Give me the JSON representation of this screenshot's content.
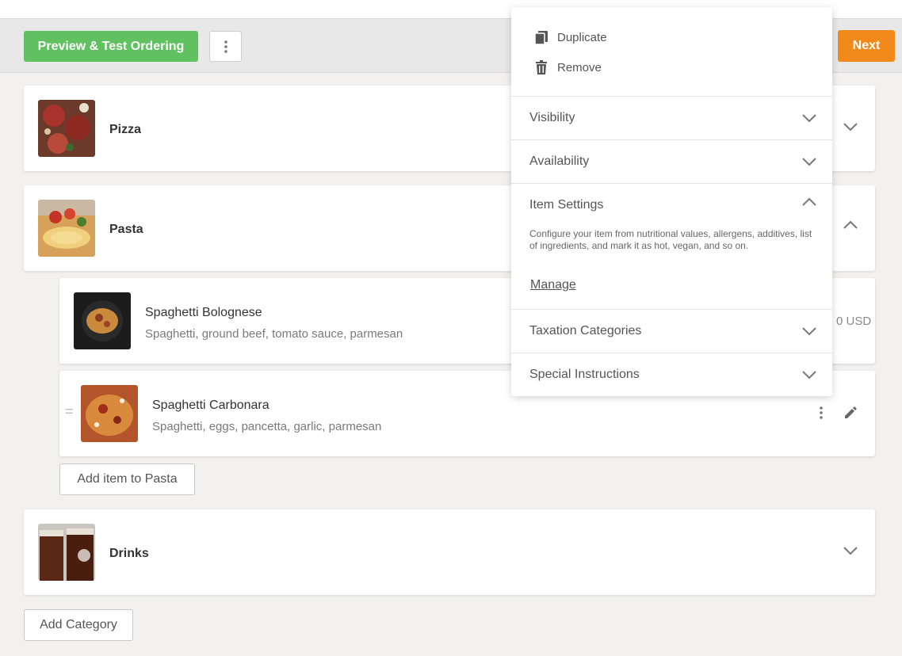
{
  "toolbar": {
    "preview_label": "Preview & Test Ordering",
    "next_label": "Next"
  },
  "categories": [
    {
      "name": "Pizza"
    },
    {
      "name": "Pasta"
    },
    {
      "name": "Drinks"
    }
  ],
  "pasta_items": [
    {
      "title": "Spaghetti Bolognese",
      "description": "Spaghetti, ground beef, tomato sauce, parmesan",
      "price_partial": "0 USD"
    },
    {
      "title": "Spaghetti Carbonara",
      "description": "Spaghetti, eggs, pancetta, garlic, parmesan"
    }
  ],
  "add_item_label": "Add item to Pasta",
  "add_category_label": "Add Category",
  "menu": {
    "duplicate": "Duplicate",
    "remove": "Remove",
    "sections": [
      {
        "label": "Visibility",
        "expanded": false
      },
      {
        "label": "Availability",
        "expanded": false
      },
      {
        "label": "Item Settings",
        "expanded": true
      },
      {
        "label": "Taxation Categories",
        "expanded": false
      },
      {
        "label": "Special Instructions",
        "expanded": false
      }
    ],
    "item_settings_description": "Configure your item from nutritional values, allergens, additives, list of ingredients, and mark it as hot, vegan, and so on.",
    "manage_link": "Manage"
  },
  "colors": {
    "preview_button": "#5fc160",
    "next_button": "#f18a1a",
    "background": "#f2f1ef"
  }
}
